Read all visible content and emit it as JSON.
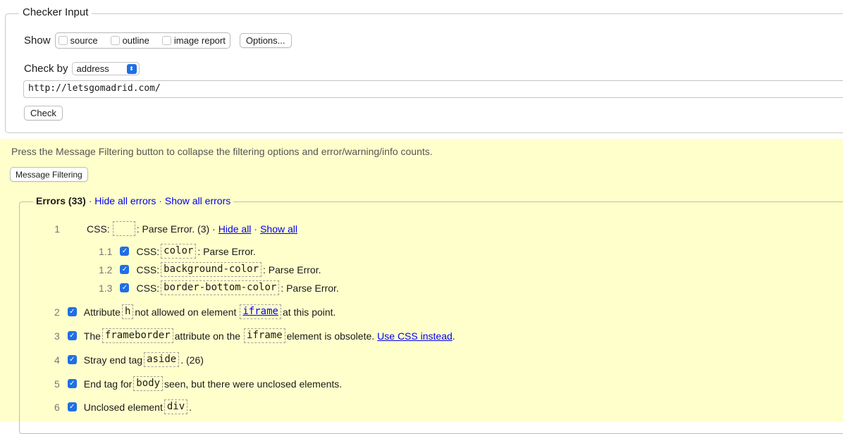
{
  "checker": {
    "legend": "Checker Input",
    "show_label": "Show",
    "show_options": [
      "source",
      "outline",
      "image report"
    ],
    "options_button": "Options...",
    "check_by_label": "Check by",
    "check_by_value": "address",
    "url_value": "http://letsgomadrid.com/",
    "check_button": "Check"
  },
  "filtering": {
    "note": "Press the Message Filtering button to collapse the filtering options and error/warning/info counts.",
    "button": "Message Filtering"
  },
  "errors": {
    "legend_title": "Errors (33)",
    "hide_all": "Hide all errors",
    "show_all": "Show all errors",
    "separator": "·",
    "group1": {
      "num": "1",
      "prefix": "CSS:",
      "text": ": Parse Error. (3) ·",
      "hide_all": "Hide all",
      "dot": "·",
      "show_all": "Show all",
      "subitems": [
        {
          "num": "1.1",
          "prefix": "CSS:",
          "code": "color",
          "text": ": Parse Error."
        },
        {
          "num": "1.2",
          "prefix": "CSS:",
          "code": "background-color",
          "text": ": Parse Error."
        },
        {
          "num": "1.3",
          "prefix": "CSS:",
          "code": "border-bottom-color",
          "text": ": Parse Error."
        }
      ]
    },
    "item2": {
      "num": "2",
      "pre": "Attribute",
      "code1": "h",
      "mid": "not allowed on element",
      "code2": "iframe",
      "post": "at this point."
    },
    "item3": {
      "num": "3",
      "pre": "The",
      "code1": "frameborder",
      "mid": "attribute on the",
      "code2": "iframe",
      "post": "element is obsolete.",
      "link": "Use CSS instead",
      "end": "."
    },
    "item4": {
      "num": "4",
      "pre": "Stray end tag",
      "code1": "aside",
      "post": ". (26)"
    },
    "item5": {
      "num": "5",
      "pre": "End tag for",
      "code1": "body",
      "post": "seen, but there were unclosed elements."
    },
    "item6": {
      "num": "6",
      "pre": "Unclosed element",
      "code1": "div",
      "post": "."
    }
  }
}
